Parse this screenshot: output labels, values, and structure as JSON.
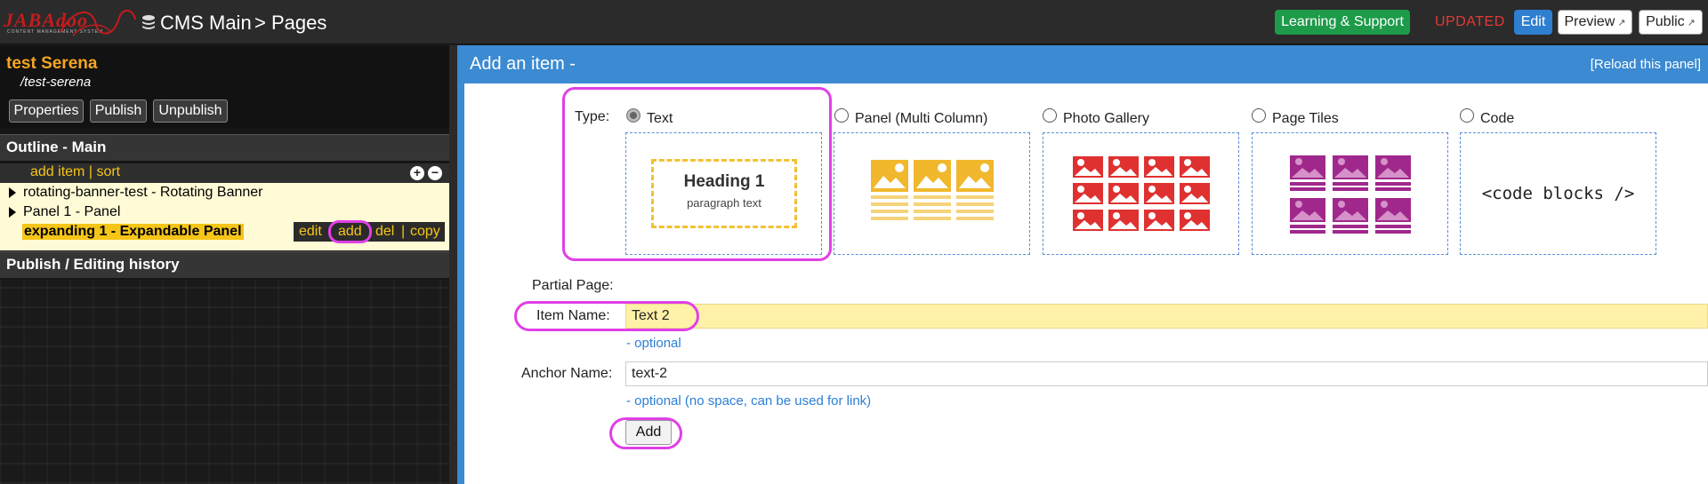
{
  "topbar": {
    "logo_text": "JABAdoo",
    "logo_subtitle": "CONTENT MANAGEMENT SYSTEM",
    "breadcrumb": [
      "CMS Main",
      "> Pages"
    ],
    "learning_label": "Learning & Support",
    "status": "UPDATED",
    "edit_label": "Edit",
    "preview_label": "Preview",
    "public_label": "Public",
    "colors": {
      "learning": "#1e9b4a",
      "status": "#e53935",
      "edit": "#2f7fd1"
    }
  },
  "sidebar": {
    "page_name": "test Serena",
    "page_path": "/test-serena",
    "buttons": [
      "Properties",
      "Publish",
      "Unpublish"
    ],
    "outline_title": "Outline - Main",
    "outline_links": {
      "add_item": "add item",
      "sep": "|",
      "sort": "sort"
    },
    "tree": [
      {
        "label": "rotating-banner-test - Rotating Banner",
        "expandable": true
      },
      {
        "label": "Panel 1 - Panel",
        "expandable": true
      },
      {
        "label": "expanding 1 - Expandable Panel",
        "expandable": false,
        "selected": true
      }
    ],
    "item_actions": [
      "edit",
      "add",
      "del",
      "copy"
    ],
    "history_title": "Publish / Editing history"
  },
  "panel": {
    "title": "Add an item -",
    "reload_label": "[Reload this panel]",
    "type_label": "Type:",
    "types": [
      {
        "label": "Text",
        "selected": true,
        "preview_heading": "Heading 1",
        "preview_text": "paragraph text"
      },
      {
        "label": "Panel (Multi Column)",
        "selected": false
      },
      {
        "label": "Photo Gallery",
        "selected": false
      },
      {
        "label": "Page Tiles",
        "selected": false
      },
      {
        "label": "Code",
        "selected": false,
        "preview_text": "<code blocks />"
      }
    ],
    "partial_page_label": "Partial Page:",
    "item_name_label": "Item Name:",
    "item_name_value": "Text 2",
    "item_name_hint": "- optional",
    "anchor_name_label": "Anchor Name:",
    "anchor_name_value": "text-2",
    "anchor_name_hint": "- optional (no space, can be used for link)",
    "add_button": "Add",
    "colors": {
      "panel_blue": "#3b8ad2",
      "highlight": "#e040e6",
      "item_name_bg": "#fff1a8",
      "gold": "#f5c518",
      "red": "#e53935",
      "purple": "#a0288c"
    }
  }
}
